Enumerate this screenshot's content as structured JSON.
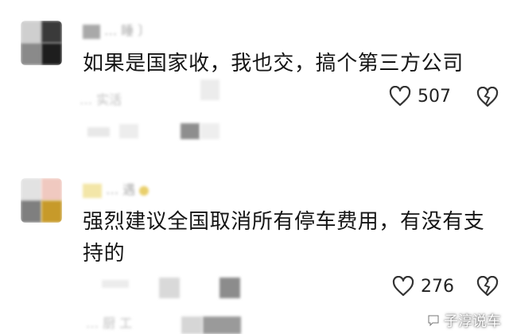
{
  "comments": [
    {
      "username_blurred": "… 睡 〕",
      "text": "如果是国家收，我也交，搞个第三方公司",
      "like_count": "507",
      "reply_preview_blurred": "… 实活"
    },
    {
      "username_blurred": "… 遇",
      "text": "强烈建议全国取消所有停车费用，有没有支持的",
      "like_count": "276",
      "reply_preview_blurred": "… 厨 工"
    }
  ],
  "watermark": {
    "text": "子淳说车"
  },
  "icons": {
    "like": "heart-outline-icon",
    "dislike": "broken-heart-icon",
    "watermark": "speech-bubble-icon"
  }
}
